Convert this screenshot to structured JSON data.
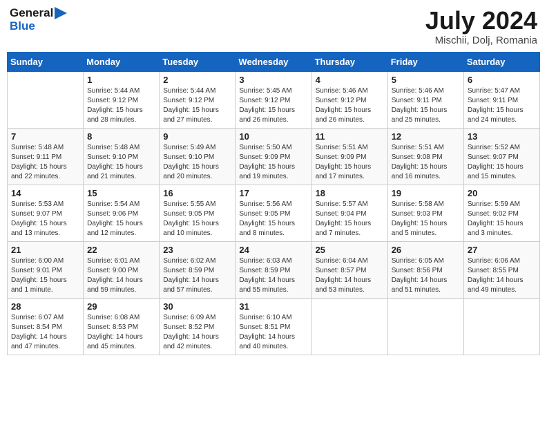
{
  "header": {
    "logo_line1": "General",
    "logo_line2": "Blue",
    "month": "July 2024",
    "location": "Mischii, Dolj, Romania"
  },
  "weekdays": [
    "Sunday",
    "Monday",
    "Tuesday",
    "Wednesday",
    "Thursday",
    "Friday",
    "Saturday"
  ],
  "weeks": [
    [
      {
        "day": "",
        "sunrise": "",
        "sunset": "",
        "daylight": ""
      },
      {
        "day": "1",
        "sunrise": "Sunrise: 5:44 AM",
        "sunset": "Sunset: 9:12 PM",
        "daylight": "Daylight: 15 hours and 28 minutes."
      },
      {
        "day": "2",
        "sunrise": "Sunrise: 5:44 AM",
        "sunset": "Sunset: 9:12 PM",
        "daylight": "Daylight: 15 hours and 27 minutes."
      },
      {
        "day": "3",
        "sunrise": "Sunrise: 5:45 AM",
        "sunset": "Sunset: 9:12 PM",
        "daylight": "Daylight: 15 hours and 26 minutes."
      },
      {
        "day": "4",
        "sunrise": "Sunrise: 5:46 AM",
        "sunset": "Sunset: 9:12 PM",
        "daylight": "Daylight: 15 hours and 26 minutes."
      },
      {
        "day": "5",
        "sunrise": "Sunrise: 5:46 AM",
        "sunset": "Sunset: 9:11 PM",
        "daylight": "Daylight: 15 hours and 25 minutes."
      },
      {
        "day": "6",
        "sunrise": "Sunrise: 5:47 AM",
        "sunset": "Sunset: 9:11 PM",
        "daylight": "Daylight: 15 hours and 24 minutes."
      }
    ],
    [
      {
        "day": "7",
        "sunrise": "Sunrise: 5:48 AM",
        "sunset": "Sunset: 9:11 PM",
        "daylight": "Daylight: 15 hours and 22 minutes."
      },
      {
        "day": "8",
        "sunrise": "Sunrise: 5:48 AM",
        "sunset": "Sunset: 9:10 PM",
        "daylight": "Daylight: 15 hours and 21 minutes."
      },
      {
        "day": "9",
        "sunrise": "Sunrise: 5:49 AM",
        "sunset": "Sunset: 9:10 PM",
        "daylight": "Daylight: 15 hours and 20 minutes."
      },
      {
        "day": "10",
        "sunrise": "Sunrise: 5:50 AM",
        "sunset": "Sunset: 9:09 PM",
        "daylight": "Daylight: 15 hours and 19 minutes."
      },
      {
        "day": "11",
        "sunrise": "Sunrise: 5:51 AM",
        "sunset": "Sunset: 9:09 PM",
        "daylight": "Daylight: 15 hours and 17 minutes."
      },
      {
        "day": "12",
        "sunrise": "Sunrise: 5:51 AM",
        "sunset": "Sunset: 9:08 PM",
        "daylight": "Daylight: 15 hours and 16 minutes."
      },
      {
        "day": "13",
        "sunrise": "Sunrise: 5:52 AM",
        "sunset": "Sunset: 9:07 PM",
        "daylight": "Daylight: 15 hours and 15 minutes."
      }
    ],
    [
      {
        "day": "14",
        "sunrise": "Sunrise: 5:53 AM",
        "sunset": "Sunset: 9:07 PM",
        "daylight": "Daylight: 15 hours and 13 minutes."
      },
      {
        "day": "15",
        "sunrise": "Sunrise: 5:54 AM",
        "sunset": "Sunset: 9:06 PM",
        "daylight": "Daylight: 15 hours and 12 minutes."
      },
      {
        "day": "16",
        "sunrise": "Sunrise: 5:55 AM",
        "sunset": "Sunset: 9:05 PM",
        "daylight": "Daylight: 15 hours and 10 minutes."
      },
      {
        "day": "17",
        "sunrise": "Sunrise: 5:56 AM",
        "sunset": "Sunset: 9:05 PM",
        "daylight": "Daylight: 15 hours and 8 minutes."
      },
      {
        "day": "18",
        "sunrise": "Sunrise: 5:57 AM",
        "sunset": "Sunset: 9:04 PM",
        "daylight": "Daylight: 15 hours and 7 minutes."
      },
      {
        "day": "19",
        "sunrise": "Sunrise: 5:58 AM",
        "sunset": "Sunset: 9:03 PM",
        "daylight": "Daylight: 15 hours and 5 minutes."
      },
      {
        "day": "20",
        "sunrise": "Sunrise: 5:59 AM",
        "sunset": "Sunset: 9:02 PM",
        "daylight": "Daylight: 15 hours and 3 minutes."
      }
    ],
    [
      {
        "day": "21",
        "sunrise": "Sunrise: 6:00 AM",
        "sunset": "Sunset: 9:01 PM",
        "daylight": "Daylight: 15 hours and 1 minute."
      },
      {
        "day": "22",
        "sunrise": "Sunrise: 6:01 AM",
        "sunset": "Sunset: 9:00 PM",
        "daylight": "Daylight: 14 hours and 59 minutes."
      },
      {
        "day": "23",
        "sunrise": "Sunrise: 6:02 AM",
        "sunset": "Sunset: 8:59 PM",
        "daylight": "Daylight: 14 hours and 57 minutes."
      },
      {
        "day": "24",
        "sunrise": "Sunrise: 6:03 AM",
        "sunset": "Sunset: 8:59 PM",
        "daylight": "Daylight: 14 hours and 55 minutes."
      },
      {
        "day": "25",
        "sunrise": "Sunrise: 6:04 AM",
        "sunset": "Sunset: 8:57 PM",
        "daylight": "Daylight: 14 hours and 53 minutes."
      },
      {
        "day": "26",
        "sunrise": "Sunrise: 6:05 AM",
        "sunset": "Sunset: 8:56 PM",
        "daylight": "Daylight: 14 hours and 51 minutes."
      },
      {
        "day": "27",
        "sunrise": "Sunrise: 6:06 AM",
        "sunset": "Sunset: 8:55 PM",
        "daylight": "Daylight: 14 hours and 49 minutes."
      }
    ],
    [
      {
        "day": "28",
        "sunrise": "Sunrise: 6:07 AM",
        "sunset": "Sunset: 8:54 PM",
        "daylight": "Daylight: 14 hours and 47 minutes."
      },
      {
        "day": "29",
        "sunrise": "Sunrise: 6:08 AM",
        "sunset": "Sunset: 8:53 PM",
        "daylight": "Daylight: 14 hours and 45 minutes."
      },
      {
        "day": "30",
        "sunrise": "Sunrise: 6:09 AM",
        "sunset": "Sunset: 8:52 PM",
        "daylight": "Daylight: 14 hours and 42 minutes."
      },
      {
        "day": "31",
        "sunrise": "Sunrise: 6:10 AM",
        "sunset": "Sunset: 8:51 PM",
        "daylight": "Daylight: 14 hours and 40 minutes."
      },
      {
        "day": "",
        "sunrise": "",
        "sunset": "",
        "daylight": ""
      },
      {
        "day": "",
        "sunrise": "",
        "sunset": "",
        "daylight": ""
      },
      {
        "day": "",
        "sunrise": "",
        "sunset": "",
        "daylight": ""
      }
    ]
  ]
}
